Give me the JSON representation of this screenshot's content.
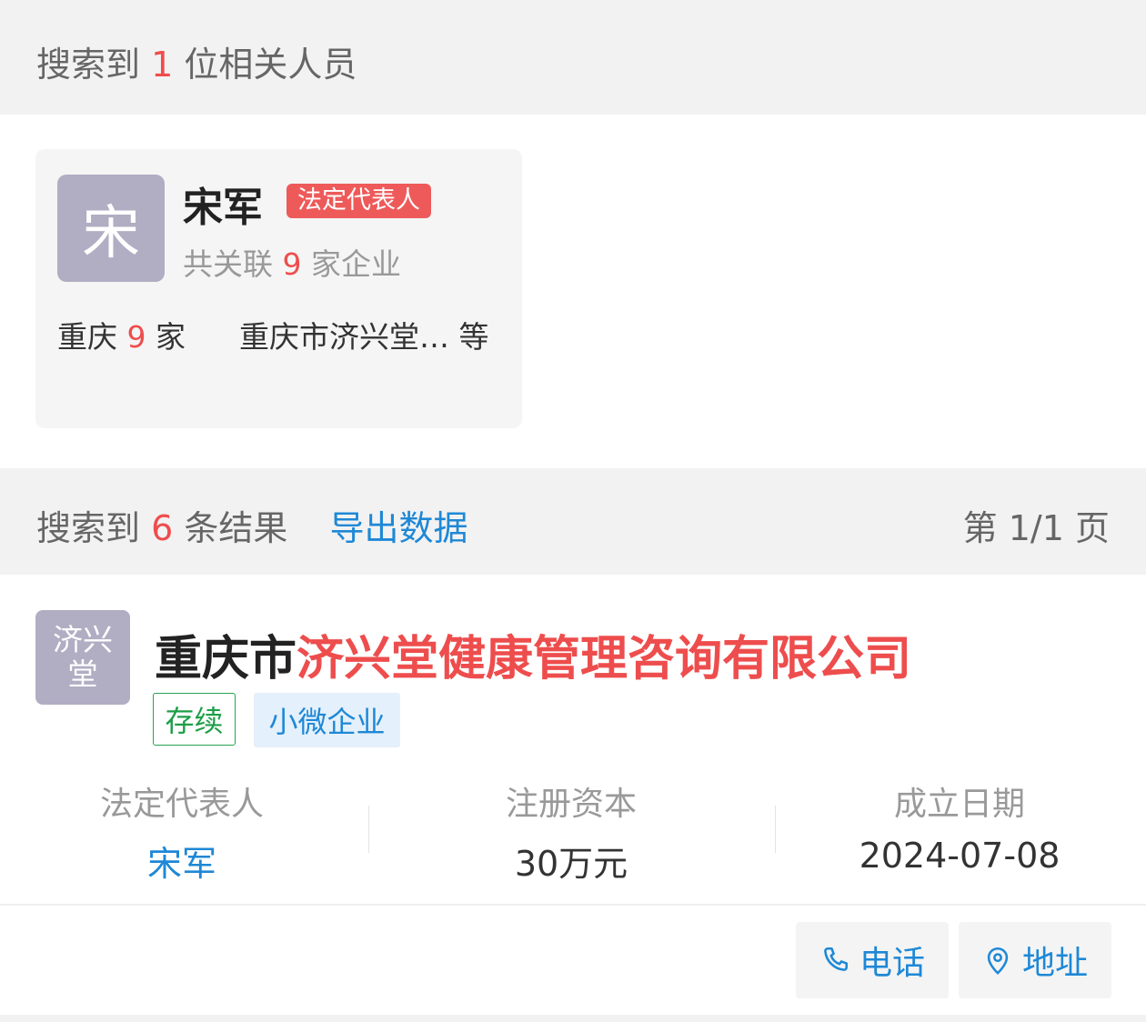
{
  "people_header": {
    "prefix": "搜索到",
    "count": "1",
    "suffix": "位相关人员"
  },
  "person": {
    "avatar": "宋",
    "name": "宋军",
    "tag": "法定代表人",
    "assoc_prefix": "共关联",
    "assoc_count": "9",
    "assoc_suffix": "家企业",
    "region_name": "重庆",
    "region_count": "9",
    "region_unit": "家",
    "companies": "重庆市济兴堂… 等"
  },
  "results_header": {
    "prefix": "搜索到",
    "count": "6",
    "suffix": "条结果",
    "export": "导出数据",
    "page_info": "第 1/1 页"
  },
  "company": {
    "logo_line1": "济兴",
    "logo_line2": "堂",
    "name_prefix": "重庆市",
    "name_highlight": "济兴堂健康管理咨询有限公司",
    "status": "存续",
    "size": "小微企业",
    "fields": [
      {
        "label": "法定代表人",
        "value": "宋军"
      },
      {
        "label": "注册资本",
        "value": "30万元"
      },
      {
        "label": "成立日期",
        "value": "2024-07-08"
      }
    ]
  },
  "actions": {
    "phone": "电话",
    "address": "地址"
  },
  "colors": {
    "accent_red": "#ee4d4d",
    "link_blue": "#1e88d6",
    "status_green": "#27a350",
    "avatar_bg": "#b1adc3"
  }
}
